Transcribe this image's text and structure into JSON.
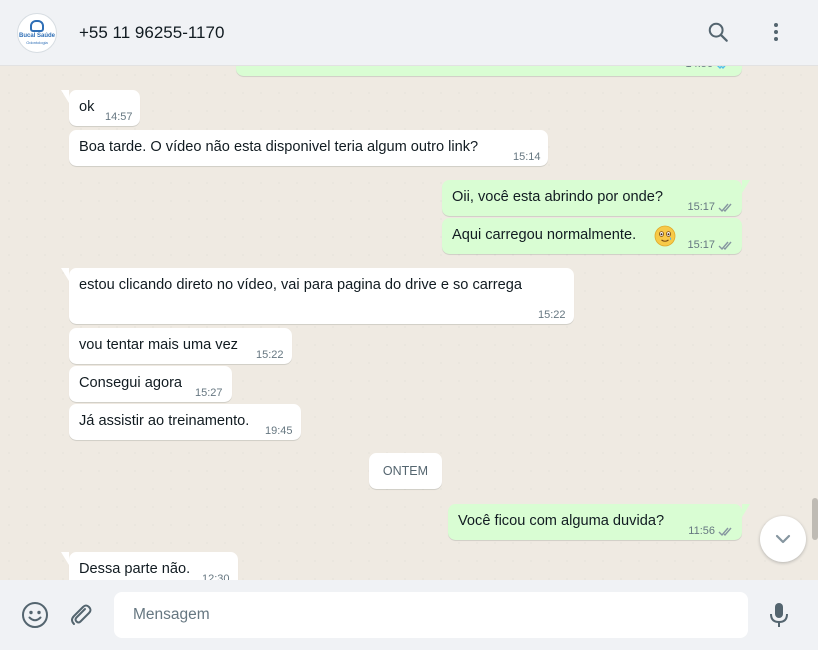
{
  "header": {
    "contact_name": "+55 11 96255-1170",
    "avatar_text": "Bucal Saúde",
    "avatar_subtext": "Odontologia",
    "search_icon": "search-icon",
    "menu_icon": "kebab-menu-icon"
  },
  "colors": {
    "incoming_bubble": "#ffffff",
    "outgoing_bubble": "#d9fdd3",
    "chat_background": "#efeae2",
    "read_ticks": "#53bdeb",
    "panel": "#f0f2f5"
  },
  "messages": [
    {
      "direction": "out",
      "text": "",
      "time": "14:56",
      "status": "read"
    },
    {
      "direction": "in",
      "text": "ok",
      "time": "14:57"
    },
    {
      "direction": "in",
      "text": "Boa tarde. O vídeo não esta disponivel teria algum outro link?",
      "time": "15:14"
    },
    {
      "direction": "out",
      "text": "Oii, você esta abrindo por onde?",
      "time": "15:17",
      "status": "read"
    },
    {
      "direction": "out",
      "text": "Aqui carregou normalmente.",
      "emoji": "smiling-face-with-tear-icon",
      "time": "15:17",
      "status": "read"
    },
    {
      "direction": "in",
      "text": "estou clicando direto no vídeo, vai para pagina do drive e so carrega",
      "time": "15:22"
    },
    {
      "direction": "in",
      "text": "vou tentar mais uma vez",
      "time": "15:22"
    },
    {
      "direction": "in",
      "text": "Consegui agora",
      "time": "15:27"
    },
    {
      "direction": "in",
      "text": "Já assistir ao treinamento.",
      "time": "19:45"
    },
    {
      "direction": "out",
      "text": "Você ficou com alguma duvida?",
      "time": "11:56",
      "status": "read"
    },
    {
      "direction": "in",
      "text": "Dessa parte não.",
      "time": "12:30"
    }
  ],
  "date_separator": "ONTEM",
  "composer": {
    "placeholder": "Mensagem",
    "emoji_icon": "emoji-icon",
    "attach_icon": "paperclip-icon",
    "mic_icon": "microphone-icon"
  },
  "scroll_down_icon": "chevron-down-icon"
}
